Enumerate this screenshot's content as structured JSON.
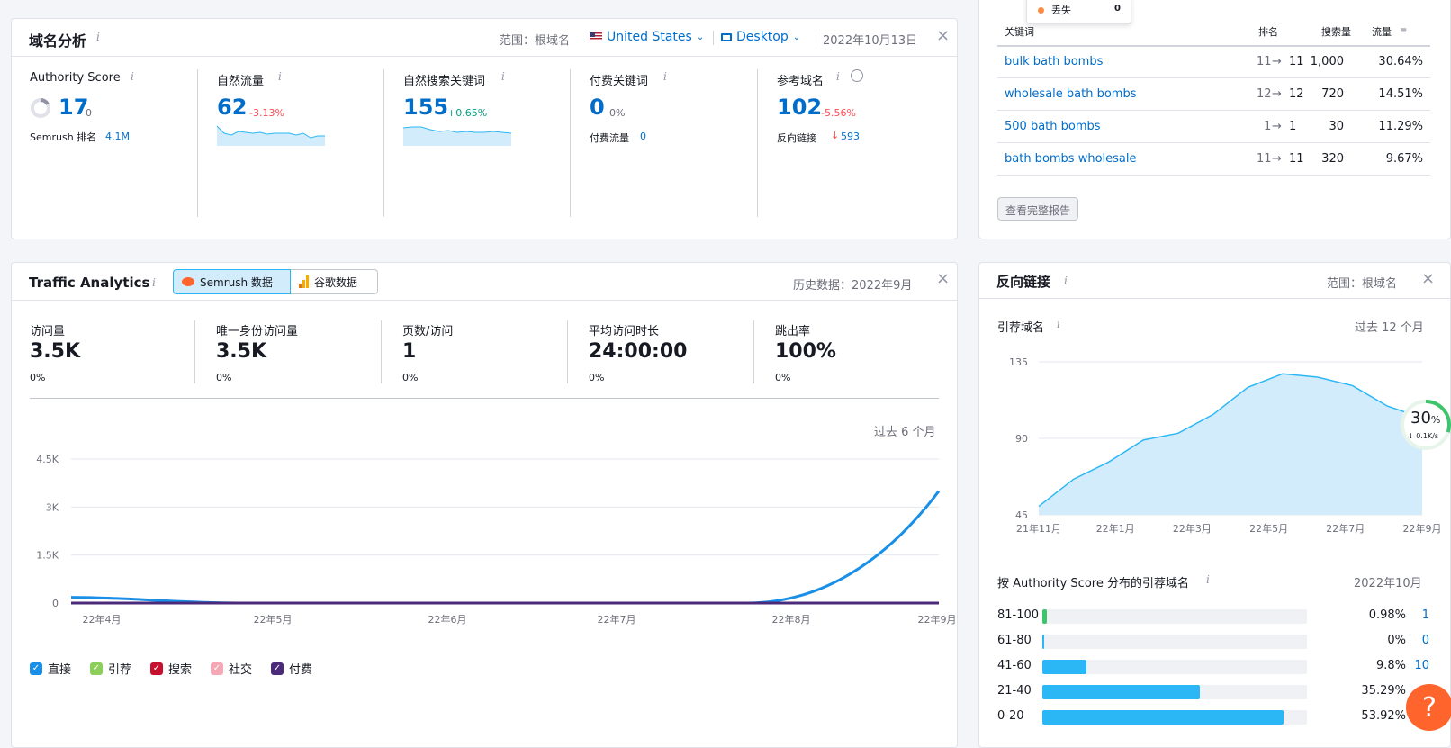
{
  "domain_overview": {
    "title": "域名分析",
    "scope_label": "范围：根域名",
    "country": "United States",
    "device": "Desktop",
    "date": "2022年10月13日",
    "metrics": [
      {
        "label": "Authority Score",
        "value": "17",
        "delta": "0",
        "sub_label": "Semrush 排名",
        "sub_value": "4.1M"
      },
      {
        "label": "自然流量",
        "value": "62",
        "delta": "-3.13%"
      },
      {
        "label": "自然搜索关键词",
        "value": "155",
        "delta": "+0.65%"
      },
      {
        "label": "付费关键词",
        "value": "0",
        "delta": "0%",
        "sub_label": "付费流量",
        "sub_value": "0"
      },
      {
        "label": "参考域名",
        "value": "102",
        "delta": "-5.56%",
        "sub_label": "反向链接",
        "sub_value": "593"
      }
    ],
    "authority_ring_fraction": 0.17
  },
  "keywords": {
    "popup_label": "丢失",
    "popup_value": "0",
    "headers": [
      "关键词",
      "排名",
      "搜索量",
      "流量"
    ],
    "rows": [
      {
        "keyword": "bulk bath bombs",
        "from": "11",
        "to": "11",
        "volume": "1,000",
        "traffic": "30.64%"
      },
      {
        "keyword": "wholesale bath bombs",
        "from": "12",
        "to": "12",
        "volume": "720",
        "traffic": "14.51%"
      },
      {
        "keyword": "500 bath bombs",
        "from": "1",
        "to": "1",
        "volume": "30",
        "traffic": "11.29%"
      },
      {
        "keyword": "bath bombs wholesale",
        "from": "11",
        "to": "11",
        "volume": "320",
        "traffic": "9.67%"
      }
    ],
    "full_report_button": "查看完整报告"
  },
  "traffic": {
    "title": "Traffic Analytics",
    "tab_semrush": "Semrush 数据",
    "tab_google": "谷歌数据",
    "history": "历史数据：2022年9月",
    "metrics": [
      {
        "label": "访问量",
        "value": "3.5K",
        "delta": "0%"
      },
      {
        "label": "唯一身份访问量",
        "value": "3.5K",
        "delta": "0%"
      },
      {
        "label": "页数/访问",
        "value": "1",
        "delta": "0%"
      },
      {
        "label": "平均访问时长",
        "value": "24:00:00",
        "delta": "0%"
      },
      {
        "label": "跳出率",
        "value": "100%",
        "delta": "0%"
      }
    ],
    "period": "过去 6 个月",
    "legend": [
      {
        "label": "直接",
        "color": "#1a8fe8"
      },
      {
        "label": "引荐",
        "color": "#8bcf5a"
      },
      {
        "label": "搜索",
        "color": "#c8102e"
      },
      {
        "label": "社交",
        "color": "#f4a7b4"
      },
      {
        "label": "付费",
        "color": "#4b2a7a"
      }
    ]
  },
  "chart_data": [
    {
      "type": "line",
      "x": [
        "22年4月",
        "22年5月",
        "22年6月",
        "22年7月",
        "22年8月",
        "22年9月"
      ],
      "y_ticks": [
        "0",
        "1.5K",
        "3K",
        "4.5K"
      ],
      "ylim": [
        0,
        4500
      ],
      "series": [
        {
          "name": "直接",
          "values": [
            180,
            0,
            0,
            0,
            0,
            3500
          ]
        },
        {
          "name": "付费",
          "values": [
            0,
            0,
            0,
            0,
            0,
            0
          ]
        }
      ]
    },
    {
      "type": "area",
      "title": "引荐域名",
      "period": "过去 12 个月",
      "x_ticks": [
        "21年11月",
        "22年1月",
        "22年3月",
        "22年5月",
        "22年7月",
        "22年9月"
      ],
      "y_ticks": [
        "45",
        "90",
        "135"
      ],
      "ylim": [
        45,
        135
      ],
      "values": [
        50,
        66,
        76,
        89,
        93,
        104,
        120,
        128,
        126,
        121,
        109,
        102
      ]
    },
    {
      "type": "bar",
      "title": "按 Authority Score 分布的引荐域名",
      "date": "2022年10月",
      "categories": [
        "81-100",
        "61-80",
        "41-60",
        "21-40",
        "0-20"
      ],
      "percent": [
        "0.98%",
        "0%",
        "9.8%",
        "35.29%",
        "53.92%"
      ],
      "values": [
        0.98,
        0,
        9.8,
        35.29,
        53.92
      ],
      "counts": [
        "1",
        "0",
        "10",
        "",
        ""
      ]
    }
  ],
  "backlinks": {
    "title": "反向链接",
    "scope_label": "范围：根域名",
    "progress_value": "30",
    "progress_unit": "%",
    "progress_speed": "↓ 0.1K/s"
  },
  "help_label": "?"
}
